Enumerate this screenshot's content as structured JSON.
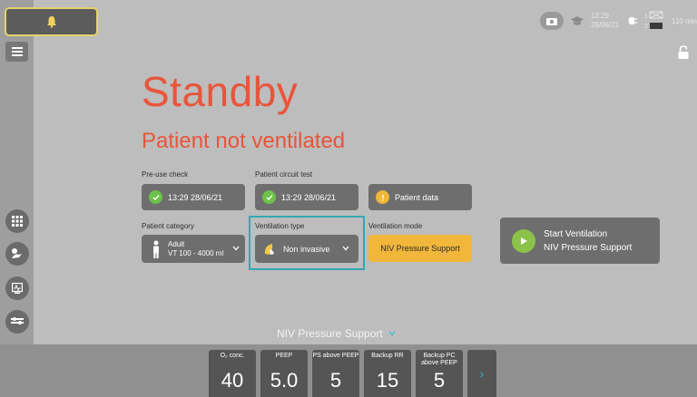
{
  "status": {
    "time": "13:29",
    "date": "28/06/21",
    "battery_label": "110 min"
  },
  "main": {
    "title": "Standby",
    "subtitle": "Patient not ventilated"
  },
  "checks": {
    "preuse_label": "Pre-use check",
    "preuse_value": "13:29 28/06/21",
    "circuit_label": "Patient circuit test",
    "circuit_value": "13:29 28/06/21",
    "patient_data": "Patient data"
  },
  "settings": {
    "category_label": "Patient category",
    "category_value": "Adult",
    "category_range": "VT 100 - 4000 ml",
    "vent_type_label": "Ventilation type",
    "vent_type_value": "Non invasive",
    "vent_mode_label": "Ventilation mode",
    "vent_mode_value": "NIV Pressure Support"
  },
  "start": {
    "line1": "Start Ventilation",
    "line2": "NIV Pressure Support"
  },
  "mode_selector": "NIV Pressure Support",
  "params": [
    {
      "name": "O₂ conc.",
      "value": "40"
    },
    {
      "name": "PEEP",
      "value": "5.0"
    },
    {
      "name": "PS above PEEP",
      "value": "5"
    },
    {
      "name": "Backup RR",
      "value": "15"
    },
    {
      "name": "Backup PC above PEEP",
      "value": "5"
    }
  ],
  "colors": {
    "accent": "#e8553a",
    "check": "#6cc24a",
    "mode": "#f0b73a",
    "highlight": "#31a9b2"
  }
}
